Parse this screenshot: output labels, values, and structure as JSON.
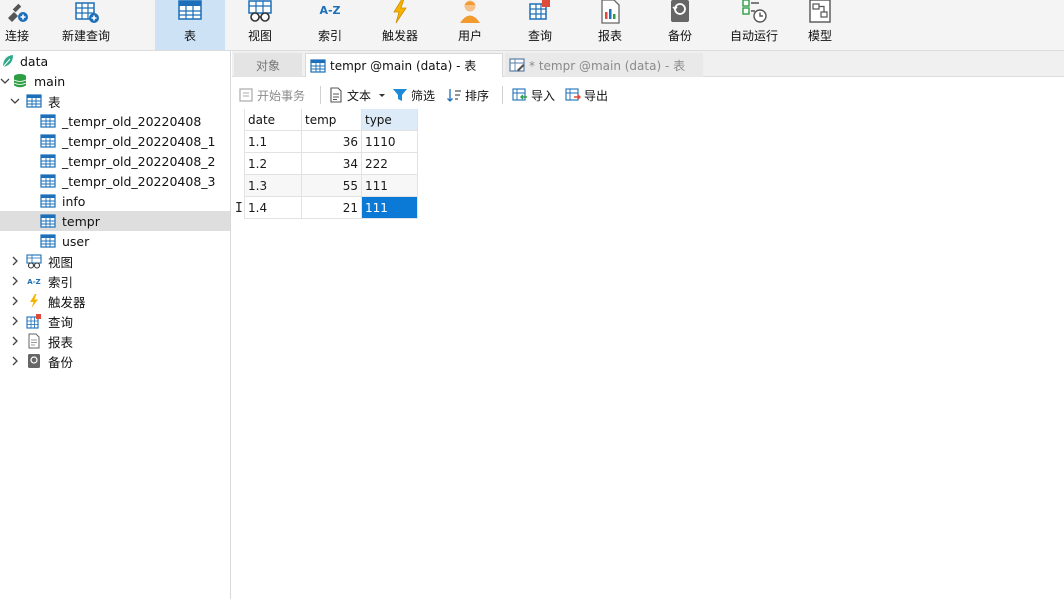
{
  "toolbar": {
    "items": [
      {
        "label": "连接"
      },
      {
        "label": "新建查询"
      },
      {
        "label": "表"
      },
      {
        "label": "视图"
      },
      {
        "label": "索引"
      },
      {
        "label": "触发器"
      },
      {
        "label": "用户"
      },
      {
        "label": "查询"
      },
      {
        "label": "报表"
      },
      {
        "label": "备份"
      },
      {
        "label": "自动运行"
      },
      {
        "label": "模型"
      }
    ],
    "index_icon_text": "A-Z",
    "active": "表"
  },
  "sidebar": {
    "connection": "data",
    "database": "main",
    "tables_group": "表",
    "tables": [
      "_tempr_old_20220408",
      "_tempr_old_20220408_1",
      "_tempr_old_20220408_2",
      "_tempr_old_20220408_3",
      "info",
      "tempr",
      "user"
    ],
    "selected_table": "tempr",
    "groups": [
      "视图",
      "索引",
      "触发器",
      "查询",
      "报表",
      "备份"
    ],
    "index_icon_text": "A-Z"
  },
  "tabs": {
    "objects": "对象",
    "tab1": "tempr @main (data) - 表",
    "tab2": "* tempr @main (data) - 表"
  },
  "subtoolbar": {
    "begin_tx": "开始事务",
    "text": "文本",
    "filter": "筛选",
    "sort": "排序",
    "import": "导入",
    "export": "导出"
  },
  "grid": {
    "columns": [
      "date",
      "temp",
      "type"
    ],
    "rows": [
      [
        "1.1",
        "36",
        "1110"
      ],
      [
        "1.2",
        "34",
        "222"
      ],
      [
        "1.3",
        "55",
        "111"
      ],
      [
        "1.4",
        "21",
        "111"
      ]
    ],
    "cursor_glyph": "I"
  },
  "colors": {
    "selection": "#0a7ad6",
    "toolbar_active": "#cde3f5",
    "db_green": "#2e9e44",
    "icon_blue": "#1c6fb8"
  }
}
